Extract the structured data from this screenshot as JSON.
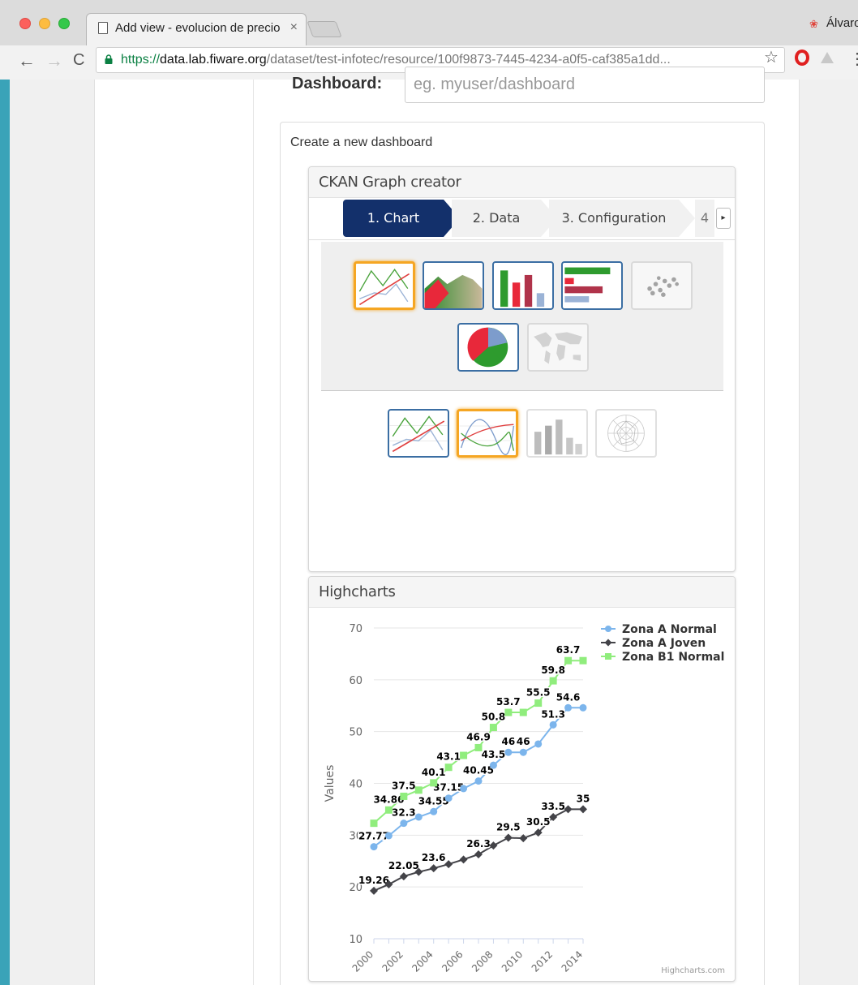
{
  "browser": {
    "tab_title": "Add view - evolucion de precio",
    "tab_close": "×",
    "profile_name": "Álvaro",
    "url_scheme": "https://",
    "url_domain": "data.lab.fiware.org",
    "url_path": "/dataset/test-infotec/resource/100f9873-7445-4234-a0f5-caf385a1dd...",
    "back_glyph": "←",
    "forward_glyph": "→",
    "reload_glyph": "C",
    "star_glyph": "☆",
    "menu_glyph": "⋮",
    "profile_glyph": "❀",
    "icons": [
      "page-icon",
      "lock-icon",
      "star-icon",
      "opera-icon",
      "drive-icon",
      "menu-icon"
    ]
  },
  "dashboard": {
    "label": "Dashboard:",
    "placeholder": "eg. myuser/dashboard",
    "value": ""
  },
  "new_dashboard": {
    "title": "Create a new dashboard"
  },
  "graph_creator": {
    "title": "CKAN Graph creator",
    "steps": [
      "1. Chart",
      "2. Data",
      "3. Configuration",
      "4"
    ],
    "active_step": "1. Chart",
    "next_glyph": "▸",
    "chart_types": [
      {
        "name": "line",
        "state": "selected"
      },
      {
        "name": "area",
        "state": "enabled"
      },
      {
        "name": "column",
        "state": "enabled"
      },
      {
        "name": "bar",
        "state": "enabled"
      },
      {
        "name": "scatter",
        "state": "disabled"
      },
      {
        "name": "pie",
        "state": "enabled"
      },
      {
        "name": "map",
        "state": "disabled"
      }
    ],
    "subtypes": [
      {
        "name": "basic-line",
        "state": "enabled"
      },
      {
        "name": "spline",
        "state": "selected"
      },
      {
        "name": "column-line",
        "state": "disabled"
      },
      {
        "name": "polar",
        "state": "disabled"
      }
    ]
  },
  "highcharts": {
    "title": "Highcharts",
    "credits": "Highcharts.com",
    "chart_data": {
      "type": "line",
      "ylabel": "Values",
      "xlabel": "",
      "ylim": [
        10,
        70
      ],
      "y_ticks": [
        10,
        20,
        30,
        40,
        50,
        60,
        70
      ],
      "x_tick_labels": [
        "2000",
        "2002",
        "2004",
        "2006",
        "2008",
        "2010",
        "2012",
        "2014"
      ],
      "x": [
        2000,
        2001,
        2002,
        2003,
        2004,
        2005,
        2006,
        2007,
        2008,
        2009,
        2010,
        2011,
        2012,
        2013,
        2014
      ],
      "legend_position": "top-right",
      "grid": true,
      "series": [
        {
          "name": "Zona A Normal",
          "color": "#7cb5ec",
          "marker": "circle",
          "values": [
            27.77,
            29.9,
            32.3,
            33.5,
            34.55,
            37.15,
            39.0,
            40.45,
            43.5,
            46,
            46,
            47.6,
            51.3,
            54.6,
            54.6
          ],
          "labels": [
            "27.77",
            "",
            "32.3",
            "",
            "34.55",
            "37.15",
            "",
            "40.45",
            "43.5",
            "46",
            "46",
            "",
            "51.3",
            "54.6",
            ""
          ]
        },
        {
          "name": "Zona A Joven",
          "color": "#434348",
          "marker": "diamond",
          "values": [
            19.26,
            20.5,
            22.05,
            22.9,
            23.6,
            24.4,
            25.3,
            26.3,
            28.0,
            29.5,
            29.4,
            30.5,
            33.5,
            35,
            35
          ],
          "labels": [
            "19.26",
            "",
            "22.05",
            "",
            "23.6",
            "",
            "",
            "26.3",
            "",
            "29.5",
            "",
            "30.5",
            "33.5",
            "",
            "35"
          ]
        },
        {
          "name": "Zona B1 Normal",
          "color": "#90ed7d",
          "marker": "square",
          "values": [
            32.3,
            34.86,
            37.5,
            38.7,
            40.1,
            43.1,
            45.4,
            46.9,
            50.8,
            53.7,
            53.7,
            55.5,
            59.8,
            63.7,
            63.7
          ],
          "labels": [
            "",
            "34.86",
            "37.5",
            "",
            "40.1",
            "43.1",
            "",
            "46.9",
            "50.8",
            "53.7",
            "",
            "55.5",
            "59.8",
            "63.7",
            ""
          ]
        }
      ]
    }
  }
}
